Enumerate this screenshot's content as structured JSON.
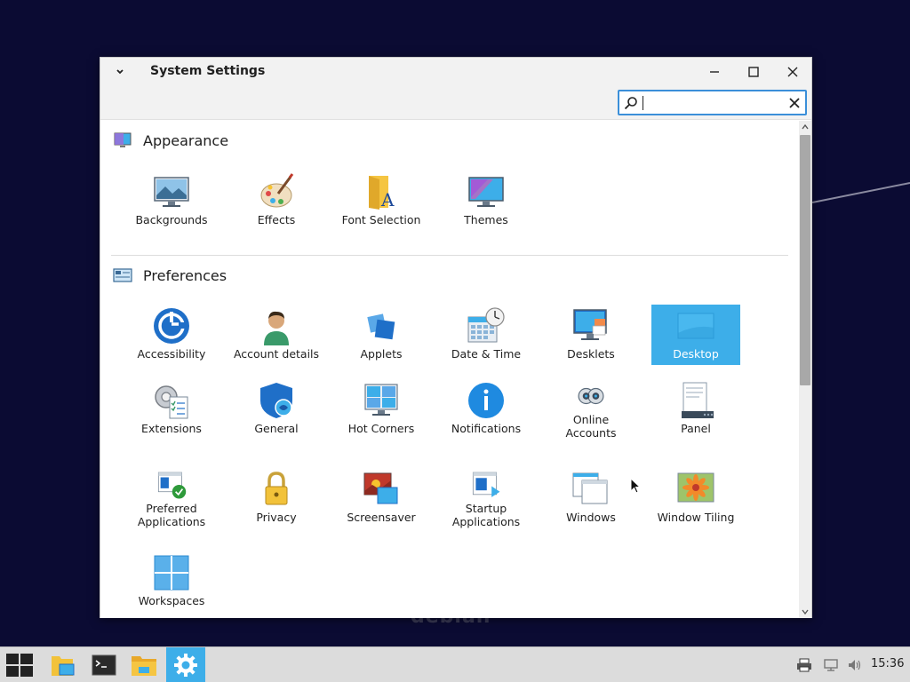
{
  "window": {
    "title": "System Settings",
    "search": {
      "value": "",
      "placeholder": ""
    }
  },
  "sections": {
    "appearance": {
      "title": "Appearance",
      "items": [
        {
          "label": "Backgrounds",
          "icon": "backgrounds-icon"
        },
        {
          "label": "Effects",
          "icon": "effects-icon"
        },
        {
          "label": "Font Selection",
          "icon": "font-selection-icon"
        },
        {
          "label": "Themes",
          "icon": "themes-icon"
        }
      ]
    },
    "preferences": {
      "title": "Preferences",
      "items": [
        {
          "label": "Accessibility",
          "icon": "accessibility-icon"
        },
        {
          "label": "Account details",
          "icon": "account-details-icon"
        },
        {
          "label": "Applets",
          "icon": "applets-icon"
        },
        {
          "label": "Date & Time",
          "icon": "date-time-icon"
        },
        {
          "label": "Desklets",
          "icon": "desklets-icon"
        },
        {
          "label": "Desktop",
          "icon": "desktop-icon",
          "selected": true
        },
        {
          "label": "Extensions",
          "icon": "extensions-icon"
        },
        {
          "label": "General",
          "icon": "general-icon"
        },
        {
          "label": "Hot Corners",
          "icon": "hot-corners-icon"
        },
        {
          "label": "Notifications",
          "icon": "notifications-icon"
        },
        {
          "label": "Online\nAccounts",
          "icon": "online-accounts-icon"
        },
        {
          "label": "Panel",
          "icon": "panel-icon"
        },
        {
          "label": "Preferred\nApplications",
          "icon": "preferred-applications-icon"
        },
        {
          "label": "Privacy",
          "icon": "privacy-icon"
        },
        {
          "label": "Screensaver",
          "icon": "screensaver-icon"
        },
        {
          "label": "Startup\nApplications",
          "icon": "startup-applications-icon"
        },
        {
          "label": "Windows",
          "icon": "windows-icon"
        },
        {
          "label": "Window Tiling",
          "icon": "window-tiling-icon"
        },
        {
          "label": "Workspaces",
          "icon": "workspaces-icon"
        }
      ]
    }
  },
  "taskbar": {
    "clock": "15:36",
    "apps": [
      "start-menu-icon",
      "file-manager-icon",
      "terminal-icon",
      "folder-icon",
      "system-settings-icon"
    ],
    "active_app": "system-settings-icon"
  },
  "colors": {
    "desktop_bg": "#0b0b33",
    "accent": "#3daee9",
    "taskbar_bg": "#dcdcdc"
  }
}
